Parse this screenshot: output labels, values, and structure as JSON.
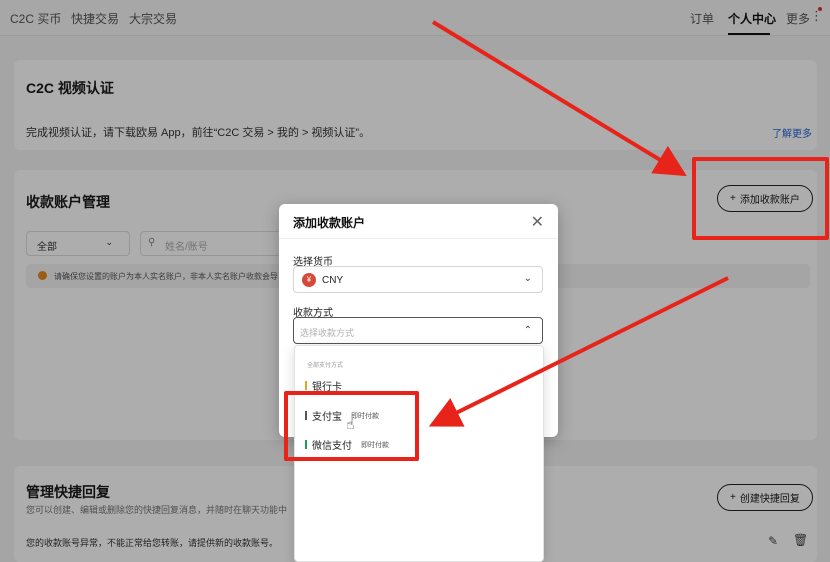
{
  "nav": {
    "left": [
      "C2C 买币",
      "快捷交易",
      "大宗交易"
    ],
    "right": {
      "orders": "订单",
      "personal_center": "个人中心",
      "more": "更多"
    }
  },
  "video_card": {
    "title": "C2C 视频认证",
    "desc": "完成视频认证，请下载欧易 App，前往“C2C 交易 > 我的 > 视频认证”。",
    "learn_more": "了解更多"
  },
  "accounts_card": {
    "title": "收款账户管理",
    "add_button": "添加收款账户",
    "filter_all": "全部",
    "search_placeholder": "姓名/账号",
    "warning": "请确保您设置的账户为本人实名账户，非本人实名账户收款会导"
  },
  "quick_reply": {
    "title": "管理快捷回复",
    "desc": "您可以创建、编辑或删除您的快捷回复消息，并随时在聊天功能中",
    "create_button": "创建快捷回复",
    "row_text": "您的收款账号异常，不能正常给您转账，请提供新的收款账号。"
  },
  "modal": {
    "title": "添加收款账户",
    "currency_label": "选择货币",
    "currency_value": "CNY",
    "currency_badge": "¥",
    "method_label": "收款方式",
    "method_placeholder": "选择收款方式"
  },
  "dropdown": {
    "header": "全部支付方式",
    "items": [
      {
        "label": "银行卡",
        "tag": "",
        "color": "#e0a81c"
      },
      {
        "label": "支付宝",
        "tag": "即时付款",
        "color": "#555555"
      },
      {
        "label": "微信支付",
        "tag": "即时付款",
        "color": "#1aa052"
      }
    ]
  },
  "colors": {
    "annotation": "#e8231a",
    "link": "#2463d6"
  }
}
